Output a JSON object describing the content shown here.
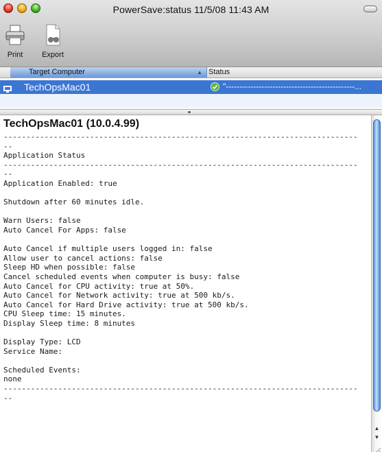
{
  "window": {
    "title": "PowerSave:status  11/5/08 11:43 AM"
  },
  "toolbar": {
    "print_label": "Print",
    "export_label": "Export"
  },
  "table": {
    "columns": [
      "Target Computer",
      "Status"
    ],
    "rows": [
      {
        "name": "TechOpsMac01",
        "status": "\"-----------------------------------------------..."
      }
    ]
  },
  "detail": {
    "heading": "TechOpsMac01 (10.0.4.99)",
    "console_lines": [
      "------------------------------------------------------------------------------",
      "--",
      "Application Status",
      "------------------------------------------------------------------------------",
      "--",
      "Application Enabled: true",
      "",
      "Shutdown after 60 minutes idle.",
      "",
      "Warn Users: false",
      "Auto Cancel For Apps: false",
      "",
      "Auto Cancel if multiple users logged in: false",
      "Allow user to cancel actions: false",
      "Sleep HD when possible: false",
      "Cancel scheduled events when computer is busy: false",
      "Auto Cancel for CPU activity: true at 50%.",
      "Auto Cancel for Network activity: true at 500 kb/s.",
      "Auto Cancel for Hard Drive activity: true at 500 kb/s.",
      "CPU Sleep time: 15 minutes.",
      "Display Sleep time: 8 minutes",
      "",
      "Display Type: LCD",
      "Service Name:",
      "",
      "Scheduled Events:",
      "none",
      "------------------------------------------------------------------------------",
      "--"
    ]
  },
  "colors": {
    "selection": "#3b76d3",
    "header_selected": "#6a99d8",
    "status_ok": "#5cb83a"
  },
  "icons": [
    "close-button",
    "minimize-button",
    "zoom-button",
    "toolbar-toggle",
    "printer-icon",
    "export-icon",
    "monitor-icon",
    "checkmark-icon"
  ]
}
